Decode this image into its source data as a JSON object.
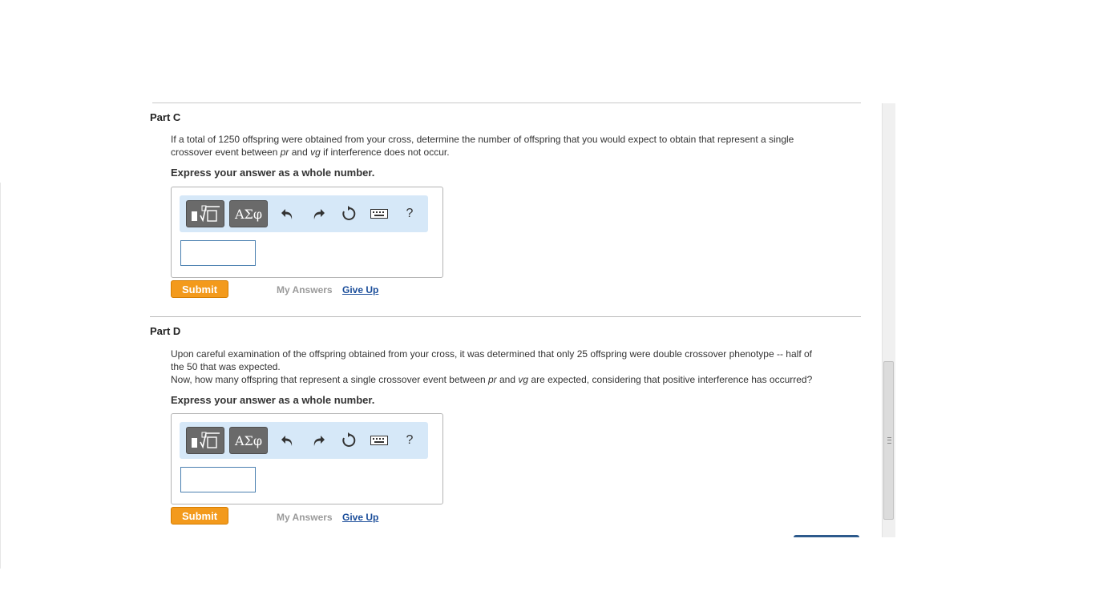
{
  "partC": {
    "title": "Part C",
    "question_line1": "If a total of 1250 offspring were obtained from your cross, determine the number of offspring that you would expect to obtain that represent a single",
    "question_line2_a": "crossover event between ",
    "term_pr": "pr",
    "and": " and ",
    "term_vg": "vg",
    "question_line2_b": " if interference does not occur.",
    "express": "Express your answer as a whole number.",
    "greek_label": "ΑΣφ",
    "help_label": "?",
    "submit_label": "Submit",
    "my_answers_label": "My Answers",
    "give_up_label": "Give Up",
    "answer_value": ""
  },
  "partD": {
    "title": "Part D",
    "question_line1": "Upon careful examination of the offspring obtained from your cross, it was determined that only 25 offspring were double crossover phenotype -- half of",
    "question_line2": "the 50 that was expected.",
    "question_line3_a": "Now, how many offspring that represent a single crossover event between ",
    "term_pr": "pr",
    "and": " and ",
    "term_vg": "vg",
    "question_line3_b": " are expected, considering that positive interference has occurred?",
    "express": "Express your answer as a whole number.",
    "greek_label": "ΑΣφ",
    "help_label": "?",
    "submit_label": "Submit",
    "my_answers_label": "My Answers",
    "give_up_label": "Give Up",
    "answer_value": ""
  },
  "colors": {
    "submit_bg": "#f39a1c",
    "toolbar_bg": "#d6e8f8",
    "link": "#1a4d9a"
  },
  "icons": [
    "templates-icon",
    "undo-icon",
    "redo-icon",
    "reset-icon",
    "keyboard-icon",
    "help-icon"
  ]
}
